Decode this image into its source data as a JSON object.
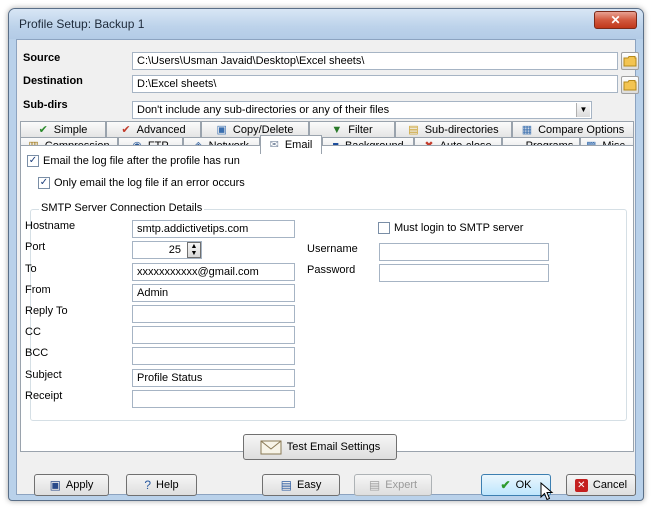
{
  "window": {
    "title": "Profile Setup: Backup 1",
    "close_glyph": "✕"
  },
  "source": {
    "label": "Source",
    "value": "C:\\Users\\Usman Javaid\\Desktop\\Excel sheets\\"
  },
  "destination": {
    "label": "Destination",
    "value": "D:\\Excel sheets\\"
  },
  "subdirs": {
    "label": "Sub-dirs",
    "value": "Don't include any sub-directories or any of their files"
  },
  "tabs_row1": [
    {
      "label": "Simple",
      "icon": "✔"
    },
    {
      "label": "Advanced",
      "icon": "✔"
    },
    {
      "label": "Copy/Delete",
      "icon": "▣"
    },
    {
      "label": "Filter",
      "icon": "▼"
    },
    {
      "label": "Sub-directories",
      "icon": "▤"
    },
    {
      "label": "Compare Options",
      "icon": "▦"
    }
  ],
  "tabs_row2": [
    {
      "label": "Compression",
      "icon": "▥"
    },
    {
      "label": "FTP",
      "icon": "◉"
    },
    {
      "label": "Network",
      "icon": "◈"
    },
    {
      "label": "Email",
      "icon": "✉"
    },
    {
      "label": "Background",
      "icon": "■"
    },
    {
      "label": "Auto-close",
      "icon": "✖"
    },
    {
      "label": "Programs",
      "icon": "▬"
    },
    {
      "label": "Misc.",
      "icon": "▩"
    }
  ],
  "email": {
    "email_log": "Email the log file after the profile has run",
    "only_error": "Only email the log file if an error occurs",
    "group_title": "SMTP Server Connection Details",
    "hostname_label": "Hostname",
    "hostname_value": "smtp.addictivetips.com",
    "port_label": "Port",
    "port_value": "25",
    "to_label": "To",
    "to_value": "xxxxxxxxxxx@gmail.com",
    "from_label": "From",
    "from_value": "Admin",
    "replyto_label": "Reply To",
    "cc_label": "CC",
    "bcc_label": "BCC",
    "subject_label": "Subject",
    "subject_value": "Profile Status",
    "receipt_label": "Receipt",
    "must_login": "Must login to SMTP server",
    "username_label": "Username",
    "password_label": "Password",
    "test_button": "Test Email Settings"
  },
  "footer": {
    "apply": "Apply",
    "help": "Help",
    "easy": "Easy",
    "expert": "Expert",
    "ok": "OK",
    "cancel": "Cancel"
  },
  "colors": {
    "window_frame": "#b9d1ea",
    "close_button": "#c0381b",
    "client_bg": "#f0f0f0",
    "ok_check": "#2e9a2e",
    "cancel_x": "#c42020"
  }
}
